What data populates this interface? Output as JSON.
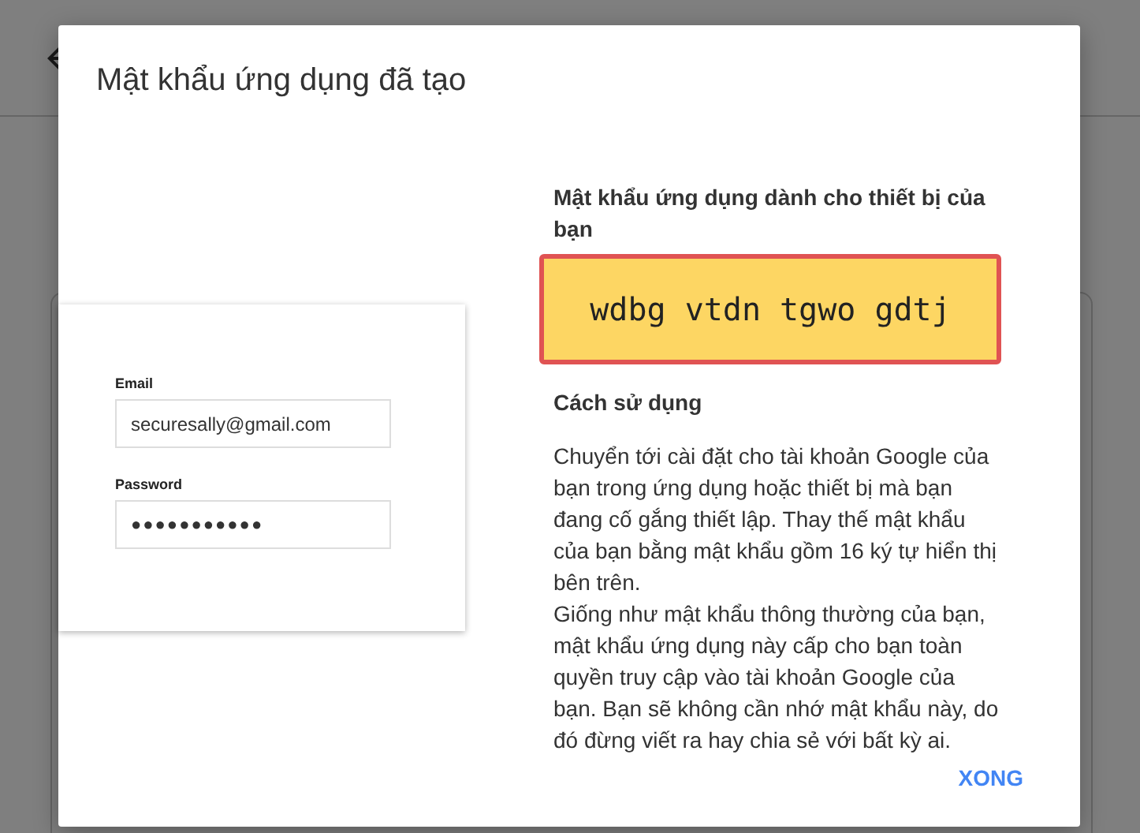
{
  "dialog": {
    "title": "Mật khẩu ứng dụng đã tạo",
    "illustration": {
      "email_label": "Email",
      "email_value": "securesally@gmail.com",
      "password_label": "Password",
      "password_value": "●●●●●●●●●●●"
    },
    "password_heading": "Mật khẩu ứng dụng dành cho thiết bị của bạn",
    "app_password": "wdbg vtdn tgwo gdtj",
    "usage_heading": "Cách sử dụng",
    "usage_paragraphs": [
      "Chuyển tới cài đặt cho tài khoản Google của bạn trong ứng dụng hoặc thiết bị mà bạn đang cố gắng thiết lập. Thay thế mật khẩu của bạn bằng mật khẩu gồm 16 ký tự hiển thị bên trên.",
      "Giống như mật khẩu thông thường của bạn, mật khẩu ứng dụng này cấp cho bạn toàn quyền truy cập vào tài khoản Google của bạn. Bạn sẽ không cần nhớ mật khẩu này, do đó đừng viết ra hay chia sẻ với bất kỳ ai."
    ],
    "done_button": "XONG"
  }
}
